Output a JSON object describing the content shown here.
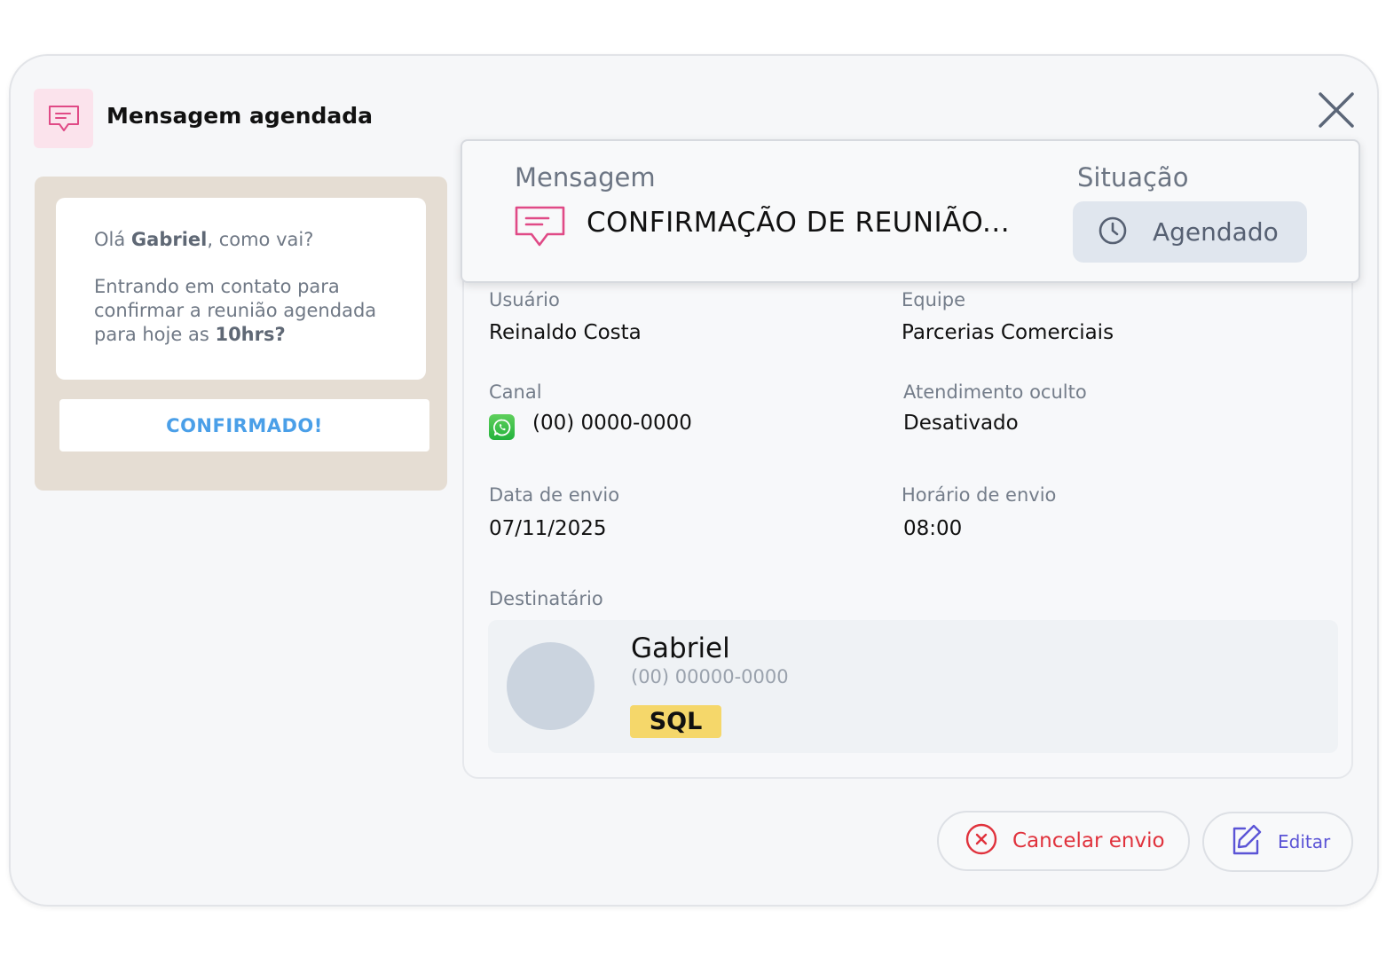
{
  "header": {
    "title": "Mensagem agendada",
    "icon": "chat-icon",
    "close_icon": "close-icon"
  },
  "preview": {
    "greeting_prefix": "Olá ",
    "greeting_name": "Gabriel",
    "greeting_suffix": ", como vai?",
    "body_text": "Entrando em contato para confirmar a reunião agendada para hoje as ",
    "body_bold": "10hrs?",
    "quick_reply": "CONFIRMADO!",
    "background_color": "#e5ddd3"
  },
  "message": {
    "label": "Mensagem",
    "text": "CONFIRMAÇÃO DE REUNIÃO...",
    "icon": "chat-icon"
  },
  "status": {
    "label": "Situação",
    "value": "Agendado",
    "icon": "clock-icon"
  },
  "fields": {
    "usuario": {
      "label": "Usuário",
      "value": "Reinaldo Costa"
    },
    "equipe": {
      "label": "Equipe",
      "value": "Parcerias Comerciais"
    },
    "canal": {
      "label": "Canal",
      "value": "(00) 0000-0000",
      "icon": "whatsapp-icon"
    },
    "atendimento": {
      "label": "Atendimento oculto",
      "value": "Desativado"
    },
    "data_envio": {
      "label": "Data de envio",
      "value": "07/11/2025"
    },
    "horario_envio": {
      "label": "Horário de envio",
      "value": "08:00"
    }
  },
  "recipient": {
    "label": "Destinatário",
    "name": "Gabriel",
    "phone": "(00) 00000-0000",
    "tag": "SQL",
    "tag_color": "#f5d76a"
  },
  "actions": {
    "cancel": {
      "label": "Cancelar envio",
      "icon": "x-circle-icon",
      "color": "#e0323c"
    },
    "edit": {
      "label": "Editar",
      "icon": "edit-icon",
      "color": "#5b54d6"
    }
  }
}
